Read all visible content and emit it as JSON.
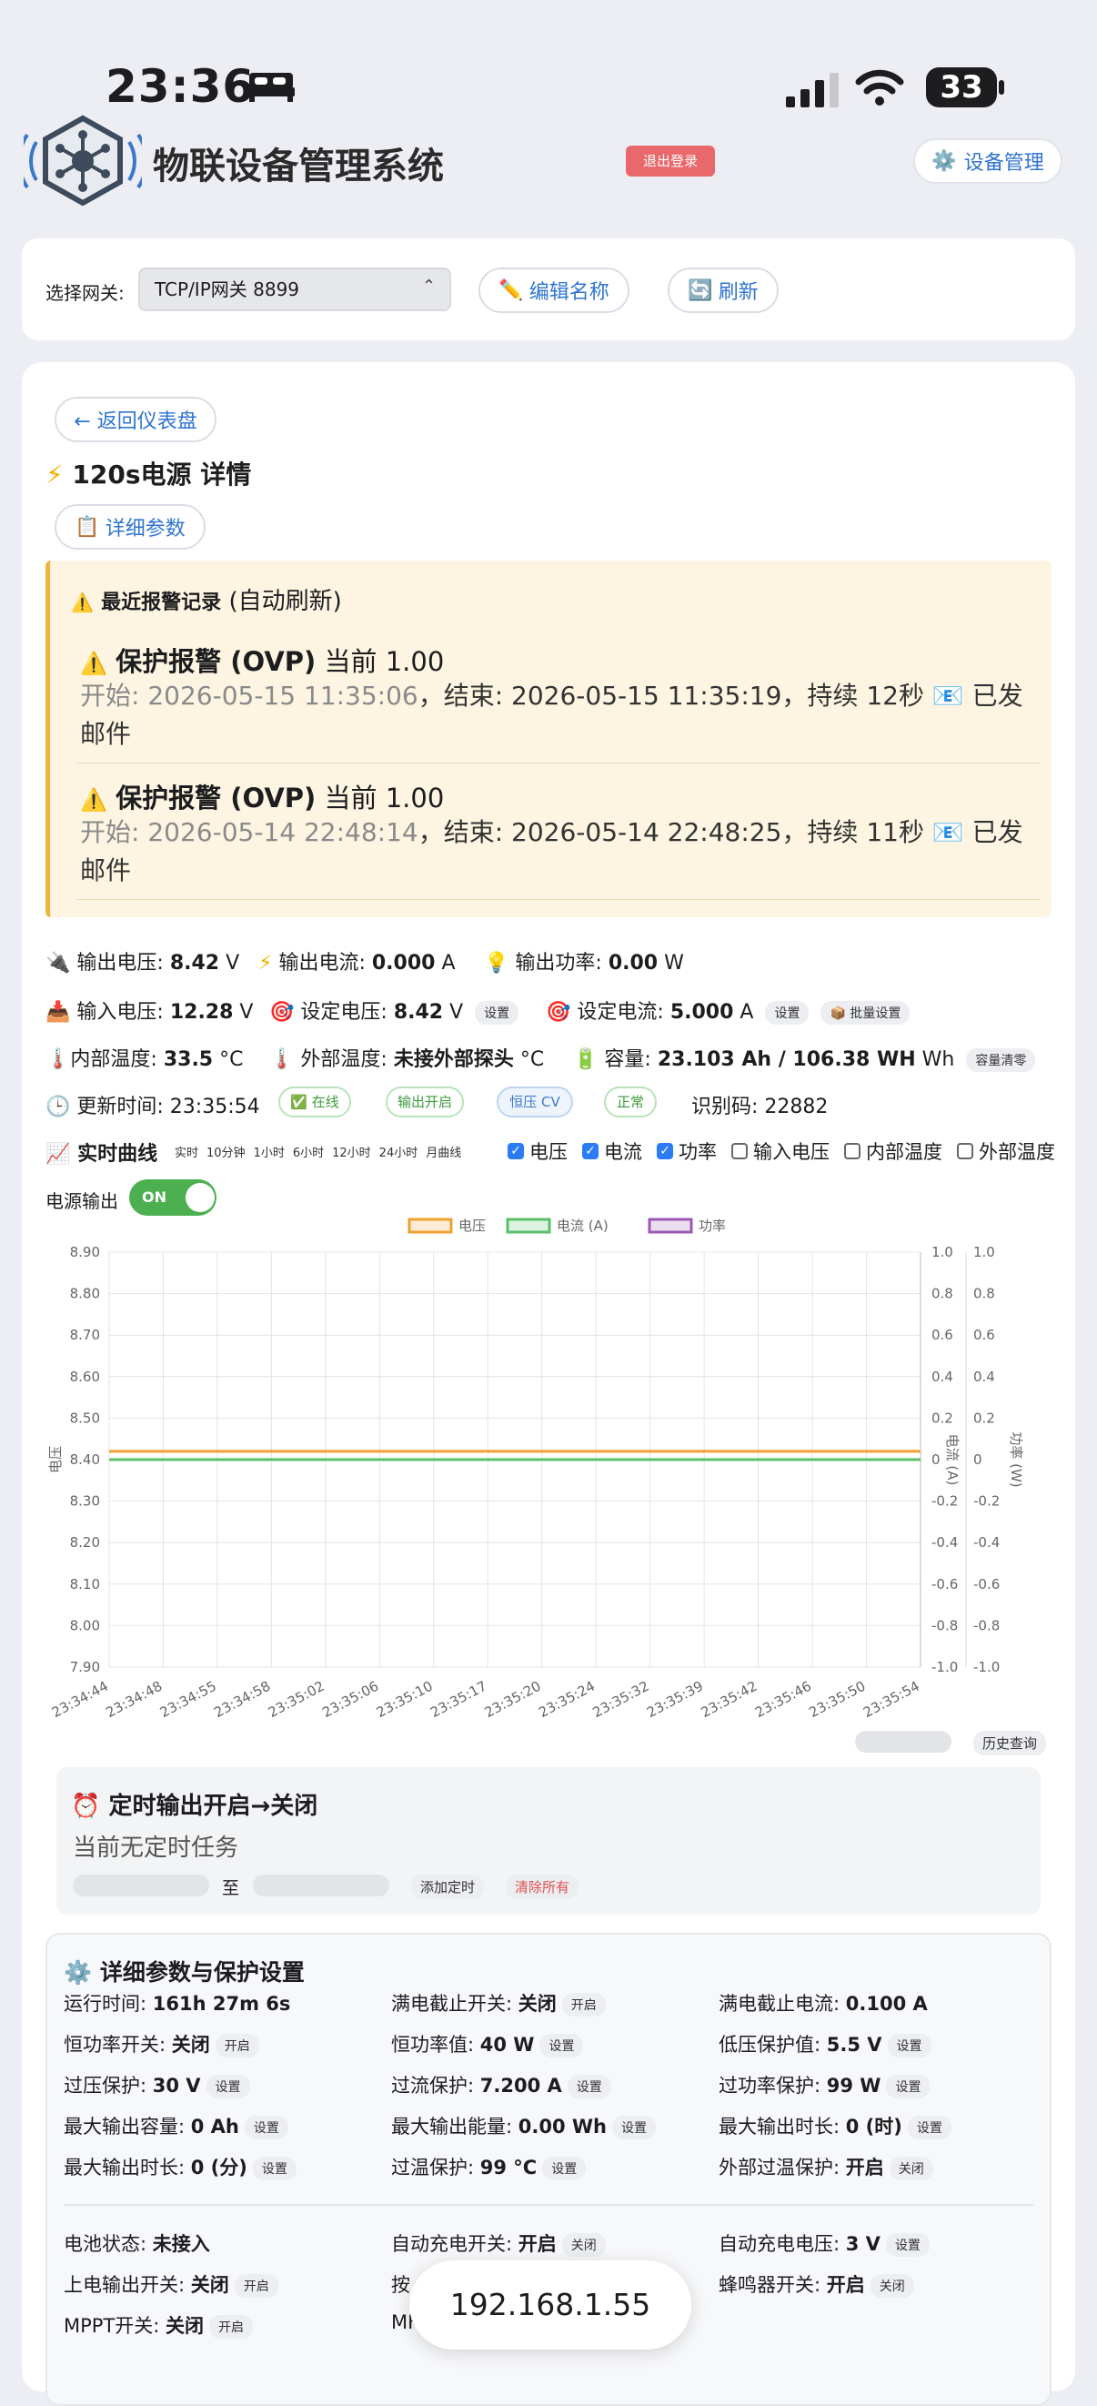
{
  "status_bar": {
    "time": "23:36",
    "battery": "33"
  },
  "header": {
    "title": "物联设备管理系统",
    "logout": "退出登录",
    "device_manage": "设备管理"
  },
  "gateway": {
    "label": "选择网关:",
    "selected": "TCP/IP网关 8899",
    "edit_label": "编辑名称",
    "refresh_label": "刷新"
  },
  "detail": {
    "back": "← 返回仪表盘",
    "title": "120s电源 详情",
    "params_btn": "详细参数"
  },
  "alarms": {
    "heading_bold": "最近报警记录",
    "heading_rest": " (自动刷新)",
    "items": [
      {
        "title": "保护报警 (OVP)",
        "current": " 当前 1.00",
        "start_label": "开始: 2026-05-15 11:35:06",
        "rest": "，结束: 2026-05-15 11:35:19，持续 12秒 📧 已发邮件"
      },
      {
        "title": "保护报警 (OVP)",
        "current": " 当前 1.00",
        "start_label": "开始: 2026-05-14 22:48:14",
        "rest": "，结束: 2026-05-14 22:48:25，持续 11秒 📧 已发邮件"
      }
    ]
  },
  "readings": {
    "out_voltage_label": "输出电压:",
    "out_voltage": "8.42",
    "v": "V",
    "out_current_label": "输出电流:",
    "out_current": "0.000",
    "a": "A",
    "out_power_label": "输出功率:",
    "out_power": "0.00",
    "w": "W",
    "in_voltage_label": "输入电压:",
    "in_voltage": "12.28",
    "set_voltage_label": "设定电压:",
    "set_voltage": "8.42",
    "set_current_label": "设定电流:",
    "set_current": "5.000",
    "set_btn": "设置",
    "batch_btn": "批量设置",
    "inner_temp_label": "内部温度:",
    "inner_temp": "33.5",
    "c": "°C",
    "outer_temp_label": "外部温度:",
    "outer_temp": "未接外部探头",
    "capacity_label": "容量:",
    "capacity": "23.103 Ah / 106.38 WH",
    "wh": "Wh",
    "clear_btn": "容量清零",
    "update_label": "更新时间: 23:35:54",
    "badge_online": "✅ 在线",
    "badge_output": "输出开启",
    "badge_cv": "恒压 CV",
    "badge_normal": "正常",
    "id_label": "识别码: 22882"
  },
  "curve": {
    "title": "实时曲线",
    "ranges": [
      "实时",
      "10分钟",
      "1小时",
      "6小时",
      "12小时",
      "24小时",
      "月曲线"
    ],
    "checks": [
      {
        "label": "电压",
        "on": true
      },
      {
        "label": "电流",
        "on": true
      },
      {
        "label": "功率",
        "on": true
      },
      {
        "label": "输入电压",
        "on": false
      },
      {
        "label": "内部温度",
        "on": false
      },
      {
        "label": "外部温度",
        "on": false
      }
    ],
    "power_label": "电源输出",
    "toggle_text": "ON",
    "history_btn": "历史查询"
  },
  "chart_data": {
    "type": "line",
    "x": [
      "23:34:44",
      "23:34:48",
      "23:34:55",
      "23:34:58",
      "23:35:02",
      "23:35:06",
      "23:35:10",
      "23:35:17",
      "23:35:20",
      "23:35:24",
      "23:35:32",
      "23:35:39",
      "23:35:42",
      "23:35:46",
      "23:35:50",
      "23:35:54"
    ],
    "series": [
      {
        "name": "电压",
        "color": "#f0a030",
        "axis": "y",
        "values": [
          8.42,
          8.42,
          8.42,
          8.42,
          8.42,
          8.42,
          8.42,
          8.42,
          8.42,
          8.42,
          8.42,
          8.42,
          8.42,
          8.42,
          8.42,
          8.42
        ]
      },
      {
        "name": "电流 (A)",
        "color": "#5cbf6a",
        "axis": "y1",
        "values": [
          0,
          0,
          0,
          0,
          0,
          0,
          0,
          0,
          0,
          0,
          0,
          0,
          0,
          0,
          0,
          0
        ]
      },
      {
        "name": "功率",
        "color": "#9b59b6",
        "axis": "y2",
        "values": [
          0,
          0,
          0,
          0,
          0,
          0,
          0,
          0,
          0,
          0,
          0,
          0,
          0,
          0,
          0,
          0
        ]
      }
    ],
    "ylabel": "电压",
    "y1label": "电流 (A)",
    "y2label": "功率 (W)",
    "ylim": [
      7.9,
      8.9
    ],
    "y1lim": [
      -1.0,
      1.0
    ],
    "y2lim": [
      -1.0,
      1.0
    ],
    "yticks": [
      "8.90",
      "8.80",
      "8.70",
      "8.60",
      "8.50",
      "8.40",
      "8.30",
      "8.20",
      "8.10",
      "8.00",
      "7.90"
    ],
    "y1ticks": [
      "1.0",
      "0.8",
      "0.6",
      "0.4",
      "0.2",
      "0",
      "-0.2",
      "-0.4",
      "-0.6",
      "-0.8",
      "-1.0"
    ],
    "grid": true,
    "legend": "top"
  },
  "timer": {
    "title": "定时输出开启→关闭",
    "empty": "当前无定时任务",
    "to": "至",
    "add": "添加定时",
    "clear": "清除所有"
  },
  "params": {
    "title": "详细参数与保护设置",
    "rows": [
      [
        {
          "label": "运行时间: ",
          "value": "161h 27m 6s",
          "btn": ""
        },
        {
          "label": "满电截止开关: ",
          "value": "关闭",
          "btn": "开启"
        },
        {
          "label": "满电截止电流: ",
          "value": "0.100 A",
          "btn": ""
        }
      ],
      [
        {
          "label": "恒功率开关: ",
          "value": "关闭",
          "btn": "开启"
        },
        {
          "label": "恒功率值: ",
          "value": "40 W",
          "btn": "设置"
        },
        {
          "label": "低压保护值: ",
          "value": "5.5 V",
          "btn": "设置"
        }
      ],
      [
        {
          "label": "过压保护: ",
          "value": "30 V",
          "btn": "设置"
        },
        {
          "label": "过流保护: ",
          "value": "7.200 A",
          "btn": "设置"
        },
        {
          "label": "过功率保护: ",
          "value": "99 W",
          "btn": "设置"
        }
      ],
      [
        {
          "label": "最大输出容量: ",
          "value": "0 Ah",
          "btn": "设置"
        },
        {
          "label": "最大输出能量: ",
          "value": "0.00 Wh",
          "btn": "设置"
        },
        {
          "label": "最大输出时长: ",
          "value": "0 (时)",
          "btn": "设置"
        }
      ],
      [
        {
          "label": "最大输出时长: ",
          "value": "0 (分)",
          "btn": "设置"
        },
        {
          "label": "过温保护: ",
          "value": "99 °C",
          "btn": "设置"
        },
        {
          "label": "外部过温保护: ",
          "value": "开启",
          "btn": "关闭"
        }
      ]
    ],
    "rows2": [
      [
        {
          "label": "电池状态: ",
          "value": "未接入",
          "btn": ""
        },
        {
          "label": "自动充电开关: ",
          "value": "开启",
          "btn": "关闭"
        },
        {
          "label": "自动充电电压: ",
          "value": "3 V",
          "btn": "设置"
        }
      ],
      [
        {
          "label": "上电输出开关: ",
          "value": "关闭",
          "btn": "开启"
        },
        {
          "label": "按",
          "value": "",
          "btn": ""
        },
        {
          "label": "蜂鸣器开关: ",
          "value": "开启",
          "btn": "关闭"
        }
      ],
      [
        {
          "label": "MPPT开关: ",
          "value": "关闭",
          "btn": "开启"
        },
        {
          "label": "MF",
          "value": "",
          "btn": ""
        },
        {
          "label": "",
          "value": "",
          "btn": ""
        }
      ]
    ]
  },
  "bubble": {
    "ip": "192.168.1.55"
  }
}
